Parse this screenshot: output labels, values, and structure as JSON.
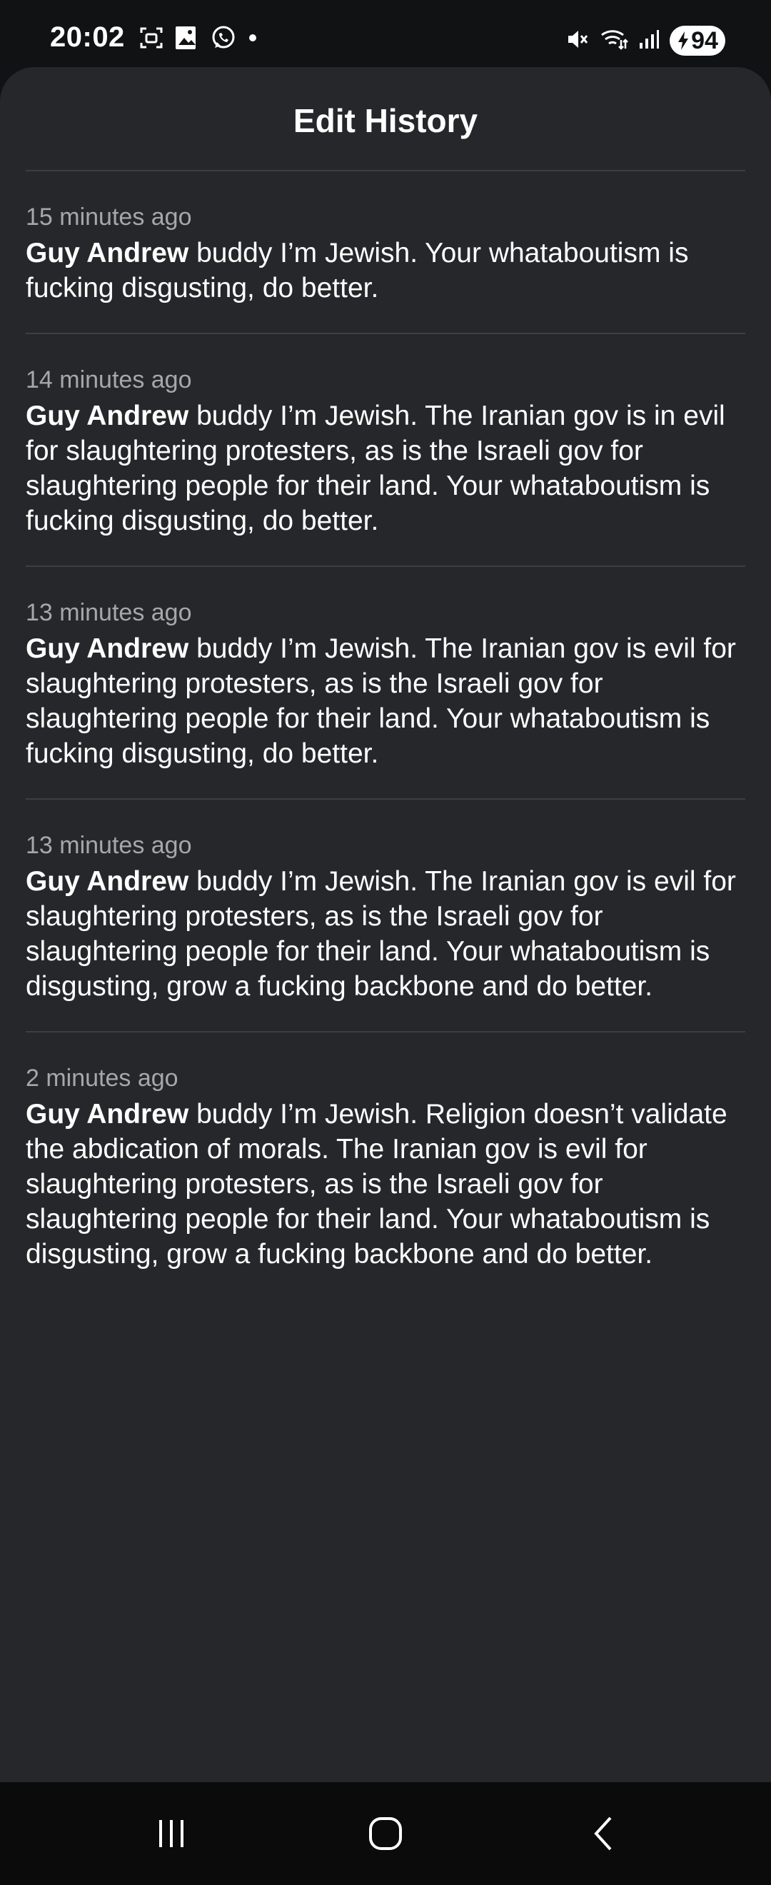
{
  "status_bar": {
    "time": "20:02",
    "battery": "94",
    "left_icons": [
      "screenshot-icon",
      "gallery-icon",
      "whatsapp-icon",
      "dot-icon"
    ],
    "right_icons": [
      "mute-icon",
      "wifi-icon",
      "signal-icon",
      "battery-icon"
    ]
  },
  "sheet": {
    "title": "Edit History"
  },
  "entries": [
    {
      "time": "15 minutes ago",
      "author": "Guy Andrew",
      "text": " buddy I’m Jewish. Your whataboutism is fucking disgusting, do better."
    },
    {
      "time": "14 minutes ago",
      "author": "Guy Andrew",
      "text": " buddy I’m Jewish. The Iranian gov is in evil for slaughtering protesters, as is the Israeli gov for slaughtering people for their land. Your whataboutism is fucking disgusting, do better."
    },
    {
      "time": "13 minutes ago",
      "author": "Guy Andrew",
      "text": " buddy I’m Jewish. The Iranian gov is evil for slaughtering protesters, as is the Israeli gov for slaughtering people for their land. Your whataboutism is fucking disgusting, do better."
    },
    {
      "time": "13 minutes ago",
      "author": "Guy Andrew",
      "text": " buddy I’m Jewish. The Iranian gov is evil for slaughtering protesters, as is the Israeli gov for slaughtering people for their land. Your whataboutism is disgusting, grow a fucking backbone and do better."
    },
    {
      "time": "2 minutes ago",
      "author": "Guy Andrew",
      "text": " buddy I’m Jewish. Religion doesn’t validate the abdication of morals. The Iranian gov is evil for slaughtering protesters, as is the Israeli gov for slaughtering people for their land. Your whataboutism is disgusting, grow a fucking backbone and do better."
    }
  ],
  "nav_bar": {
    "buttons": [
      "recent-apps-icon",
      "home-icon",
      "back-icon"
    ]
  }
}
